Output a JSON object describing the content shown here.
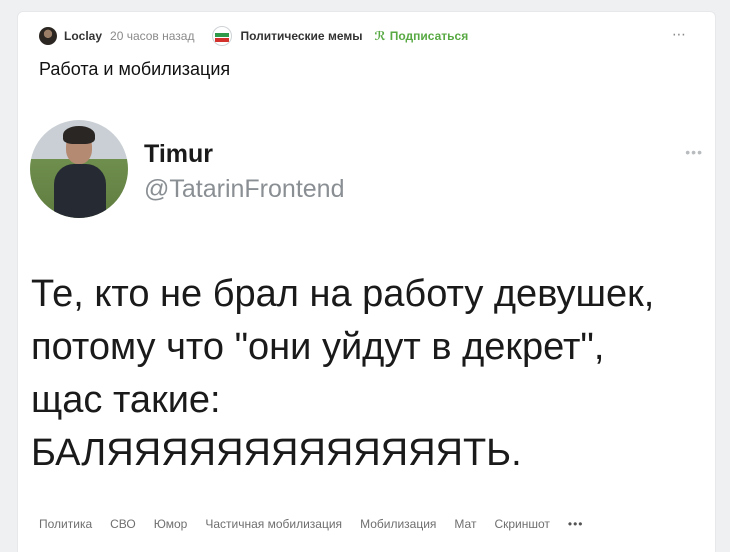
{
  "header": {
    "author": "Loclay",
    "time": "20 часов назад",
    "community": "Политические мемы",
    "subscribe": "Подписаться",
    "menu": "⋯"
  },
  "post": {
    "title": "Работа и мобилизация"
  },
  "tweet": {
    "name": "Timur",
    "handle": "@TatarinFrontend",
    "menu": "•••",
    "lines": [
      "Те, кто не брал на работу девушек,",
      "потому что \"они уйдут в декрет\",",
      "щас такие:",
      "БАЛЯЯЯЯЯЯЯЯЯЯЯЯЯТЬ."
    ]
  },
  "tags": [
    "Политика",
    "СВО",
    "Юмор",
    "Частичная мобилизация",
    "Мобилизация",
    "Мат",
    "Скриншот"
  ],
  "tags_more": "•••"
}
